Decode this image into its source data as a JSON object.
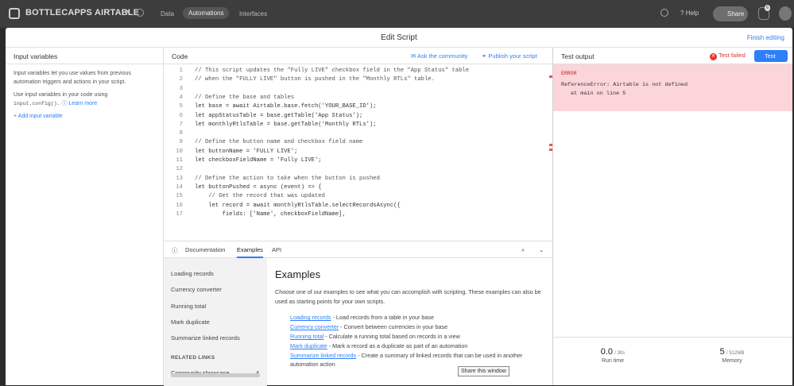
{
  "topbar": {
    "base_name": "BOTTLECAPPS AIRTABLE",
    "caret": "▾",
    "nav": [
      "Data",
      "Automations",
      "Interfaces"
    ],
    "help": "Help",
    "share": "Share",
    "notifications": "6"
  },
  "modal": {
    "title": "Edit Script",
    "finish": "Finish editing"
  },
  "input_vars": {
    "title": "Input variables",
    "p1": "Input variables let you use values from previous automation triggers and actions in your script.",
    "p2a": "Use input variables in your code using",
    "code": "input.config().",
    "learn_more": "Learn more",
    "add": "Add input variable"
  },
  "code_pane": {
    "title": "Code",
    "ask": "Ask the community",
    "publish": "Publish your script"
  },
  "code_lines": [
    {
      "n": "1",
      "t": "// This script updates the \"Fully LIVE\" checkbox field in the \"App Status\" table"
    },
    {
      "n": "2",
      "t": "// when the \"FULLY LIVE\" button is pushed in the \"Monthly RTLs\" table."
    },
    {
      "n": "3",
      "t": ""
    },
    {
      "n": "4",
      "t": "// Define the base and tables"
    },
    {
      "n": "5",
      "t": "let base = await Airtable.base.fetch('YOUR_BASE_ID');"
    },
    {
      "n": "6",
      "t": "let appStatusTable = base.getTable('App Status');"
    },
    {
      "n": "7",
      "t": "let monthlyRtlsTable = base.getTable('Monthly RTLs');"
    },
    {
      "n": "8",
      "t": ""
    },
    {
      "n": "9",
      "t": "// Define the button name and checkbox field name"
    },
    {
      "n": "10",
      "t": "let buttonName = 'FULLY LIVE';"
    },
    {
      "n": "11",
      "t": "let checkboxFieldName = 'Fully LIVE';"
    },
    {
      "n": "12",
      "t": ""
    },
    {
      "n": "13",
      "t": "// Define the action to take when the button is pushed"
    },
    {
      "n": "14",
      "t": "let buttonPushed = async (event) => {"
    },
    {
      "n": "15",
      "t": "    // Get the record that was updated"
    },
    {
      "n": "16",
      "t": "    let record = await monthlyRtlsTable.selectRecordsAsync({"
    },
    {
      "n": "17",
      "t": "        fields: ['Name', checkboxFieldName],"
    }
  ],
  "docs": {
    "tabs": [
      "Documentation",
      "Examples",
      "API"
    ],
    "nav": [
      "Loading records",
      "Currency converter",
      "Running total",
      "Mark duplicate",
      "Summarize linked records"
    ],
    "related_heading": "RELATED LINKS",
    "community": "Community showcase",
    "title": "Examples",
    "desc": "Choose one of our examples to see what you can accomplish with scripting. These examples can also be used as starting points for your own scripts.",
    "examples": [
      {
        "name": "Loading records",
        "desc": " - Load records from a table in your base"
      },
      {
        "name": "Currency converter",
        "desc": " - Convert between currencies in your base"
      },
      {
        "name": "Running total",
        "desc": " - Calculate a running total based on records in a view"
      },
      {
        "name": "Mark duplicate",
        "desc": " - Mark a record as a duplicate as part of an automation"
      },
      {
        "name": "Summarize linked records",
        "desc": " - Create a summary of linked records that can be used in another automation action"
      }
    ],
    "share_window": "Share this window"
  },
  "test": {
    "title": "Test output",
    "failed": "Test failed",
    "button": "Test",
    "error_label": "ERROR",
    "error_msg": "ReferenceError: Airtable is not defined",
    "error_at": "at main on line 5",
    "run_time": "0.0",
    "run_time_unit": "/ 30s",
    "run_time_label": "Run time",
    "memory": "5",
    "memory_unit": "/ 512MB",
    "memory_label": "Memory"
  }
}
